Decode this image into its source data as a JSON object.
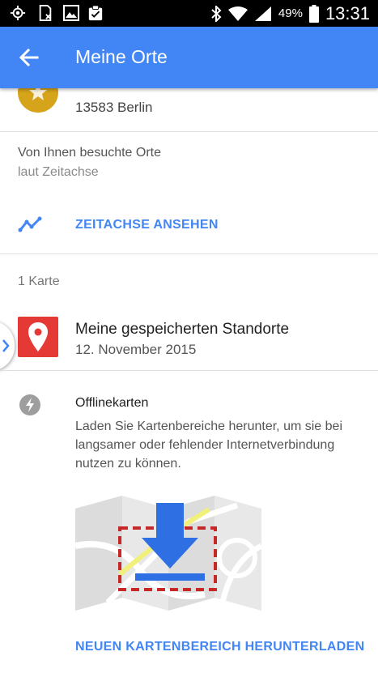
{
  "status_bar": {
    "battery": "49%",
    "time": "13:31",
    "icons": [
      "gps-icon",
      "sim-icon",
      "gallery-icon",
      "clipboard-icon",
      "bluetooth-icon",
      "wifi-icon",
      "signal-icon",
      "battery-icon"
    ]
  },
  "app_bar": {
    "title": "Meine Orte",
    "back_icon": "arrow-back-icon"
  },
  "place": {
    "address": "13583 Berlin",
    "icon": "star-icon",
    "icon_color": "#d6a41a"
  },
  "visited": {
    "title": "Von Ihnen besuchte Orte",
    "subtitle": "laut Zeitachse"
  },
  "timeline": {
    "link_label": "ZEITACHSE ANSEHEN",
    "icon": "timeline-icon"
  },
  "maps": {
    "count_label": "1 Karte",
    "items": [
      {
        "title": "Meine gespeicherten Standorte",
        "date": "12. November 2015",
        "icon": "map-pin-icon",
        "icon_bg": "#e53935"
      }
    ]
  },
  "offline": {
    "title": "Offlinekarten",
    "description": "Laden Sie Kartenbereiche herunter, um sie bei langsamer oder fehlender Internetverbindung nutzen zu können.",
    "action_label": "NEUEN KARTENBEREICH HERUNTERLADEN",
    "icon": "lightning-icon"
  },
  "colors": {
    "accent": "#4285f4",
    "status_bar": "#000000",
    "divider": "#e0e0e0"
  }
}
